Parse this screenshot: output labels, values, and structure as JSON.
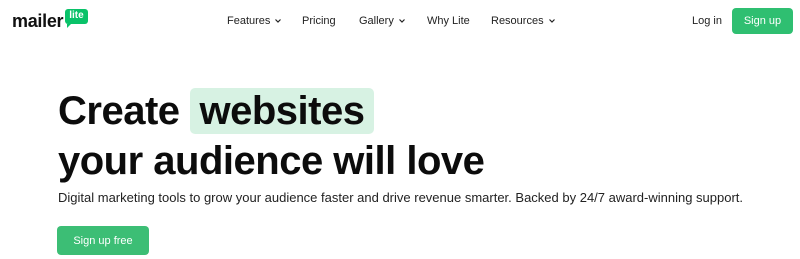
{
  "brand": {
    "name": "mailer",
    "badge": "lite",
    "accent": "#09c269"
  },
  "nav": {
    "items": [
      {
        "label": "Features",
        "has_dropdown": true
      },
      {
        "label": "Pricing",
        "has_dropdown": false
      },
      {
        "label": "Gallery",
        "has_dropdown": true
      },
      {
        "label": "Why Lite",
        "has_dropdown": false
      },
      {
        "label": "Resources",
        "has_dropdown": true
      }
    ],
    "login_label": "Log in",
    "signup_label": "Sign up"
  },
  "hero": {
    "line1_prefix": "Create",
    "line1_highlight": "websites",
    "line2": "your audience will love",
    "subtitle": "Digital marketing tools to grow your audience faster and drive revenue smarter. Backed by 24/7 award-winning support.",
    "cta_label": "Sign up free",
    "highlight_color": "#d7f2e3",
    "button_color": "#3cbe75"
  }
}
